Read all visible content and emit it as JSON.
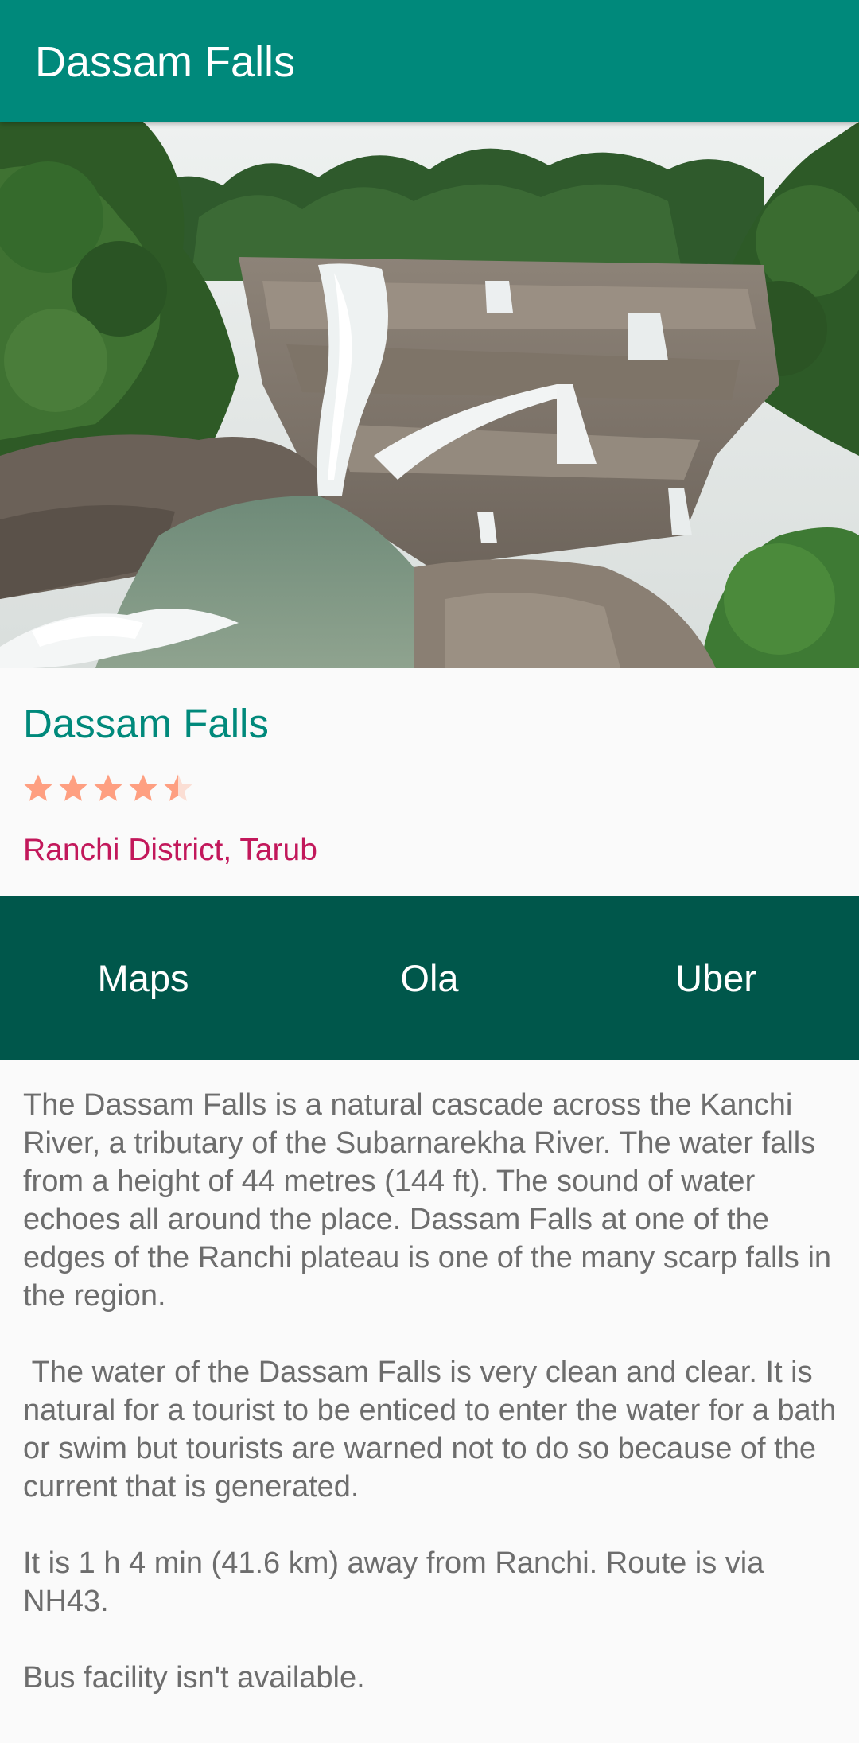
{
  "app_bar": {
    "title": "Dassam Falls"
  },
  "place": {
    "title": "Dassam Falls",
    "rating": 4.5,
    "rating_max": 5,
    "location": "Ranchi District, Tarub",
    "star_color": "#ff8a65"
  },
  "actions": {
    "maps": "Maps",
    "ola": "Ola",
    "uber": "Uber"
  },
  "description": {
    "p1": "The Dassam Falls is a natural cascade across the Kanchi River, a tributary of the Subarnarekha River. The water falls from a height of 44 metres (144 ft). The sound of water echoes all around the place. Dassam Falls at one of the edges of the Ranchi plateau is one of the many scarp falls in the region.",
    "p2": " The water of the Dassam Falls is very clean and clear. It is natural for a tourist to be enticed to enter the water for a bath or swim but tourists are warned not to do so because of the current that is generated.",
    "p3": "It is 1 h 4 min (41.6 km) away from Ranchi. Route is via NH43.",
    "p4": "Bus facility isn't available."
  },
  "colors": {
    "primary": "#00897b",
    "primary_dark": "#00574b",
    "accent": "#c2185b",
    "text_secondary": "#6d6d6d"
  }
}
